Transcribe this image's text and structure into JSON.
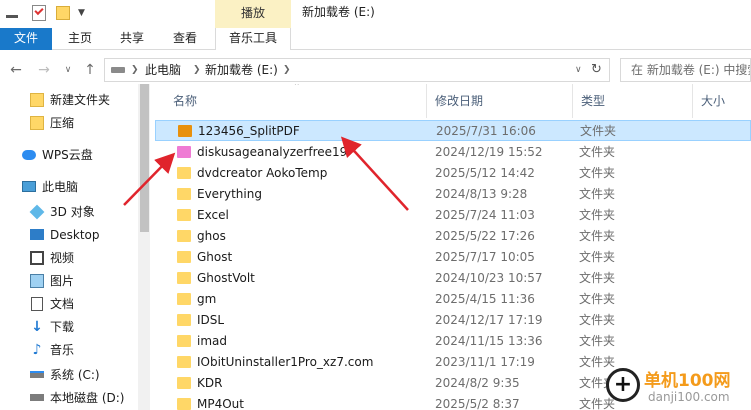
{
  "titlebar": {
    "context_tab": "播放",
    "window_title": "新加载卷 (E:)"
  },
  "ribbon": {
    "tabs": [
      {
        "label": "文件"
      },
      {
        "label": "主页"
      },
      {
        "label": "共享"
      },
      {
        "label": "查看"
      },
      {
        "label": "音乐工具"
      }
    ]
  },
  "address": {
    "crumbs": [
      "此电脑",
      "新加载卷 (E:)"
    ],
    "search_placeholder": "在 新加载卷 (E:) 中搜索"
  },
  "sidebar": {
    "items": [
      {
        "label": "新建文件夹",
        "icon": "folder-icon"
      },
      {
        "label": "压缩",
        "icon": "folder-icon"
      },
      {
        "label": "WPS云盘",
        "icon": "cloud-icon"
      },
      {
        "label": "此电脑",
        "icon": "computer-icon"
      },
      {
        "label": "3D 对象",
        "icon": "3d-objects-icon"
      },
      {
        "label": "Desktop",
        "icon": "desktop-icon"
      },
      {
        "label": "视频",
        "icon": "video-icon"
      },
      {
        "label": "图片",
        "icon": "pictures-icon"
      },
      {
        "label": "文档",
        "icon": "documents-icon"
      },
      {
        "label": "下载",
        "icon": "download-icon"
      },
      {
        "label": "音乐",
        "icon": "music-icon"
      },
      {
        "label": "系统 (C:)",
        "icon": "drive-icon"
      },
      {
        "label": "本地磁盘 (D:)",
        "icon": "drive-icon"
      }
    ]
  },
  "list": {
    "columns": {
      "name": "名称",
      "date": "修改日期",
      "type": "类型",
      "size": "大小"
    },
    "rows": [
      {
        "name": "123456_SplitPDF",
        "date": "2025/7/31 16:06",
        "type": "文件夹",
        "selected": true,
        "icon_color": "#e8900c"
      },
      {
        "name": "diskusageanalyzerfree19",
        "date": "2024/12/19 15:52",
        "type": "文件夹",
        "icon_color": "#ef7bd4"
      },
      {
        "name": "dvdcreator AokoTemp",
        "date": "2025/5/12 14:42",
        "type": "文件夹",
        "icon_color": "#ffd767"
      },
      {
        "name": "Everything",
        "date": "2024/8/13 9:28",
        "type": "文件夹",
        "icon_color": "#ffd767"
      },
      {
        "name": "Excel",
        "date": "2025/7/24 11:03",
        "type": "文件夹",
        "icon_color": "#ffd767"
      },
      {
        "name": "ghos",
        "date": "2025/5/22 17:26",
        "type": "文件夹",
        "icon_color": "#ffd767"
      },
      {
        "name": "Ghost",
        "date": "2025/7/17 10:05",
        "type": "文件夹",
        "icon_color": "#ffd767"
      },
      {
        "name": "GhostVolt",
        "date": "2024/10/23 10:57",
        "type": "文件夹",
        "icon_color": "#ffd767"
      },
      {
        "name": "gm",
        "date": "2025/4/15 11:36",
        "type": "文件夹",
        "icon_color": "#ffd767"
      },
      {
        "name": "IDSL",
        "date": "2024/12/17 17:19",
        "type": "文件夹",
        "icon_color": "#ffd767"
      },
      {
        "name": "imad",
        "date": "2024/11/15 13:36",
        "type": "文件夹",
        "icon_color": "#ffd767"
      },
      {
        "name": "IObitUninstaller1Pro_xz7.com",
        "date": "2023/11/1 17:19",
        "type": "文件夹",
        "icon_color": "#ffd767"
      },
      {
        "name": "KDR",
        "date": "2024/8/2 9:35",
        "type": "文件夹",
        "icon_color": "#ffd767"
      },
      {
        "name": "MP4Out",
        "date": "2025/5/2 8:37",
        "type": "文件夹",
        "icon_color": "#ffd767"
      }
    ]
  },
  "watermark": {
    "brand": "单机100网",
    "domain": "danji100.com"
  },
  "colors": {
    "accent": "#1979ca",
    "selection": "#cce8ff",
    "annotation_arrow": "#e0242c"
  }
}
